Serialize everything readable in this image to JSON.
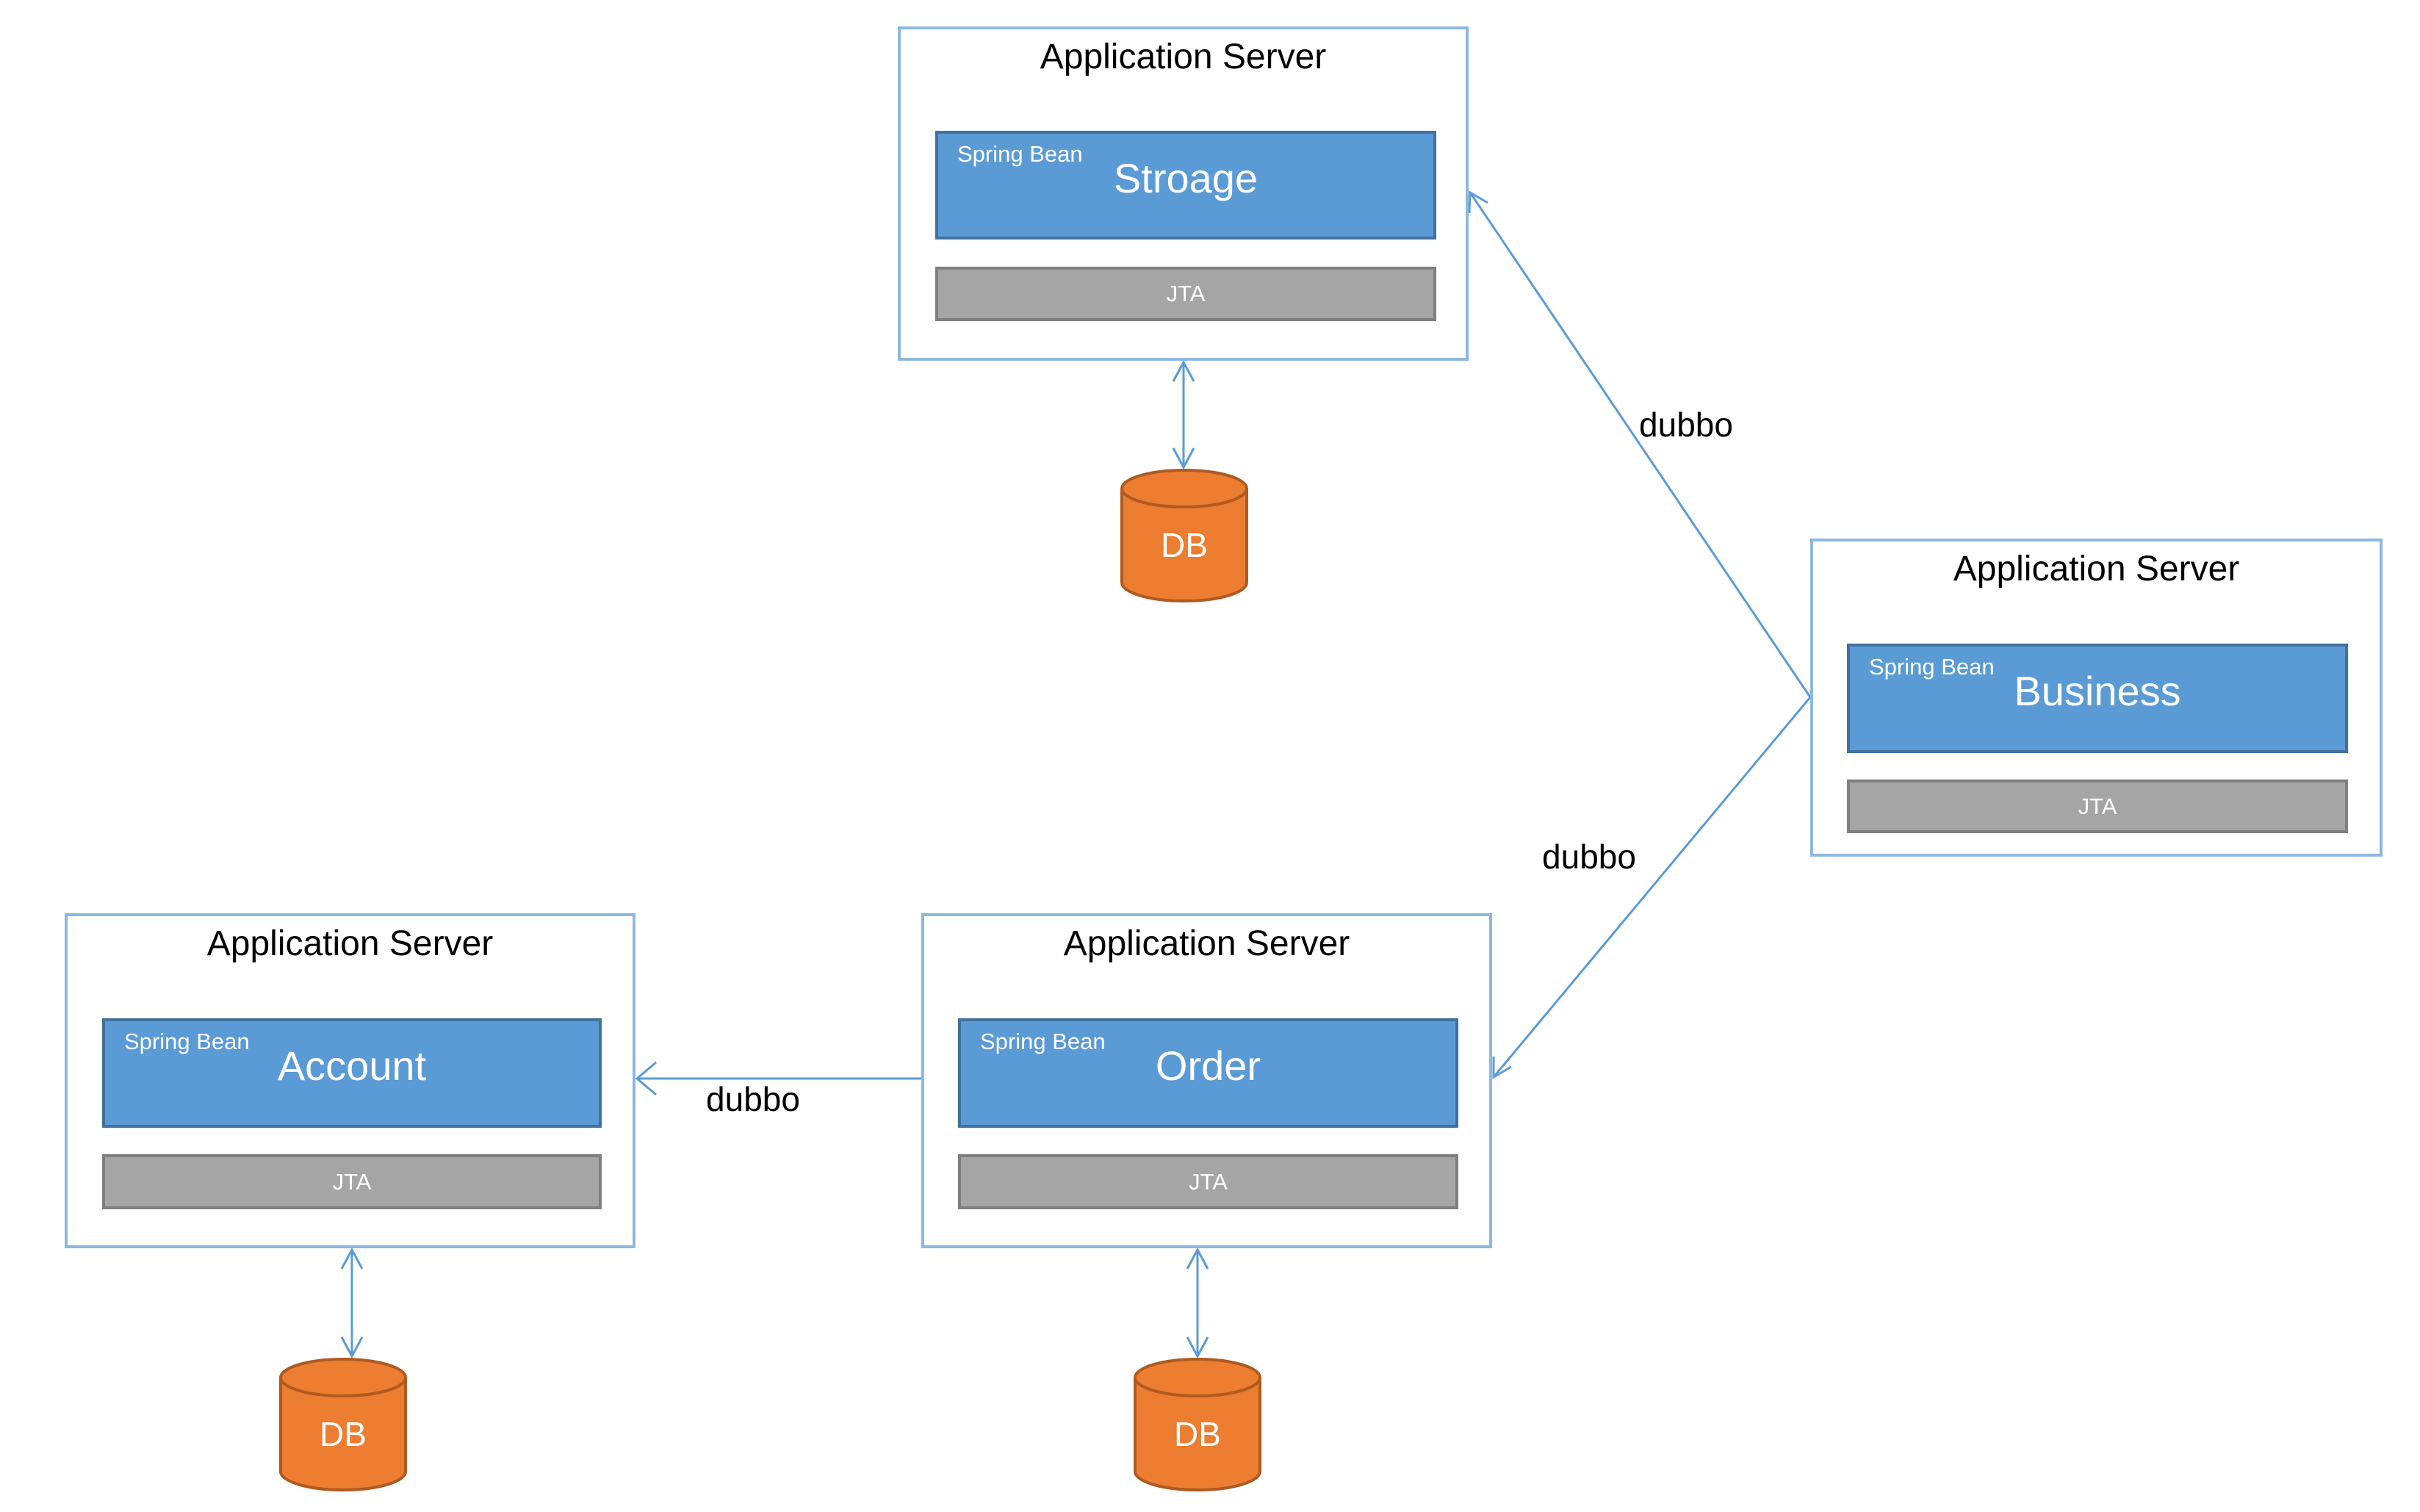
{
  "colors": {
    "server_border": "#8CB8E0",
    "bean_fill": "#5B9BD5",
    "bean_border": "#41719C",
    "jta_fill": "#A5A5A5",
    "jta_border": "#7F7F7F",
    "db_fill": "#ED7D31",
    "db_border": "#AE5A21",
    "arrow": "#5B9BD5"
  },
  "servers": {
    "storage": {
      "title": "Application Server",
      "bean_tag": "Spring Bean",
      "bean_name": "Stroage",
      "jta": "JTA",
      "db": "DB"
    },
    "business": {
      "title": "Application Server",
      "bean_tag": "Spring Bean",
      "bean_name": "Business",
      "jta": "JTA"
    },
    "account": {
      "title": "Application Server",
      "bean_tag": "Spring Bean",
      "bean_name": "Account",
      "jta": "JTA",
      "db": "DB"
    },
    "order": {
      "title": "Application Server",
      "bean_tag": "Spring Bean",
      "bean_name": "Order",
      "jta": "JTA",
      "db": "DB"
    }
  },
  "connections": [
    {
      "from": "Business",
      "to": "Stroage",
      "label": "dubbo"
    },
    {
      "from": "Business",
      "to": "Order",
      "label": "dubbo"
    },
    {
      "from": "Order",
      "to": "Account",
      "label": "dubbo"
    }
  ]
}
